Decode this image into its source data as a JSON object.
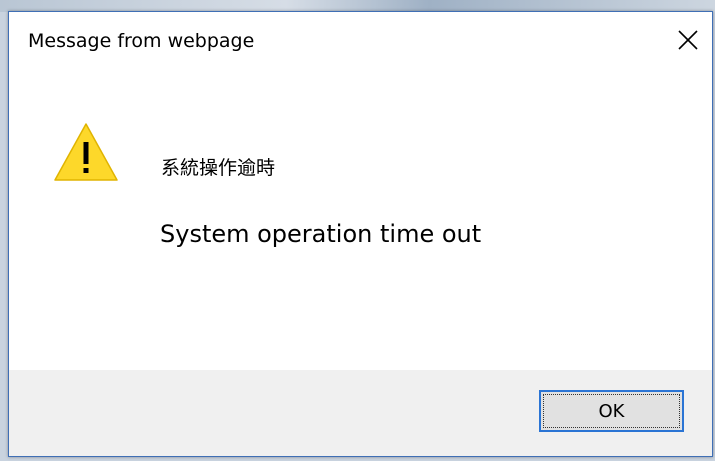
{
  "dialog": {
    "title": "Message from webpage",
    "close_icon": "close-icon",
    "warning_icon": "warning-icon",
    "message_line1": "系統操作逾時",
    "message_line2": "System operation time out",
    "ok_label": "OK"
  },
  "colors": {
    "dialog_border": "#3f6fb5",
    "button_focus_border": "#2a74d4",
    "warning_fill": "#fdd82a",
    "footer_bg": "#f0f0f0"
  }
}
